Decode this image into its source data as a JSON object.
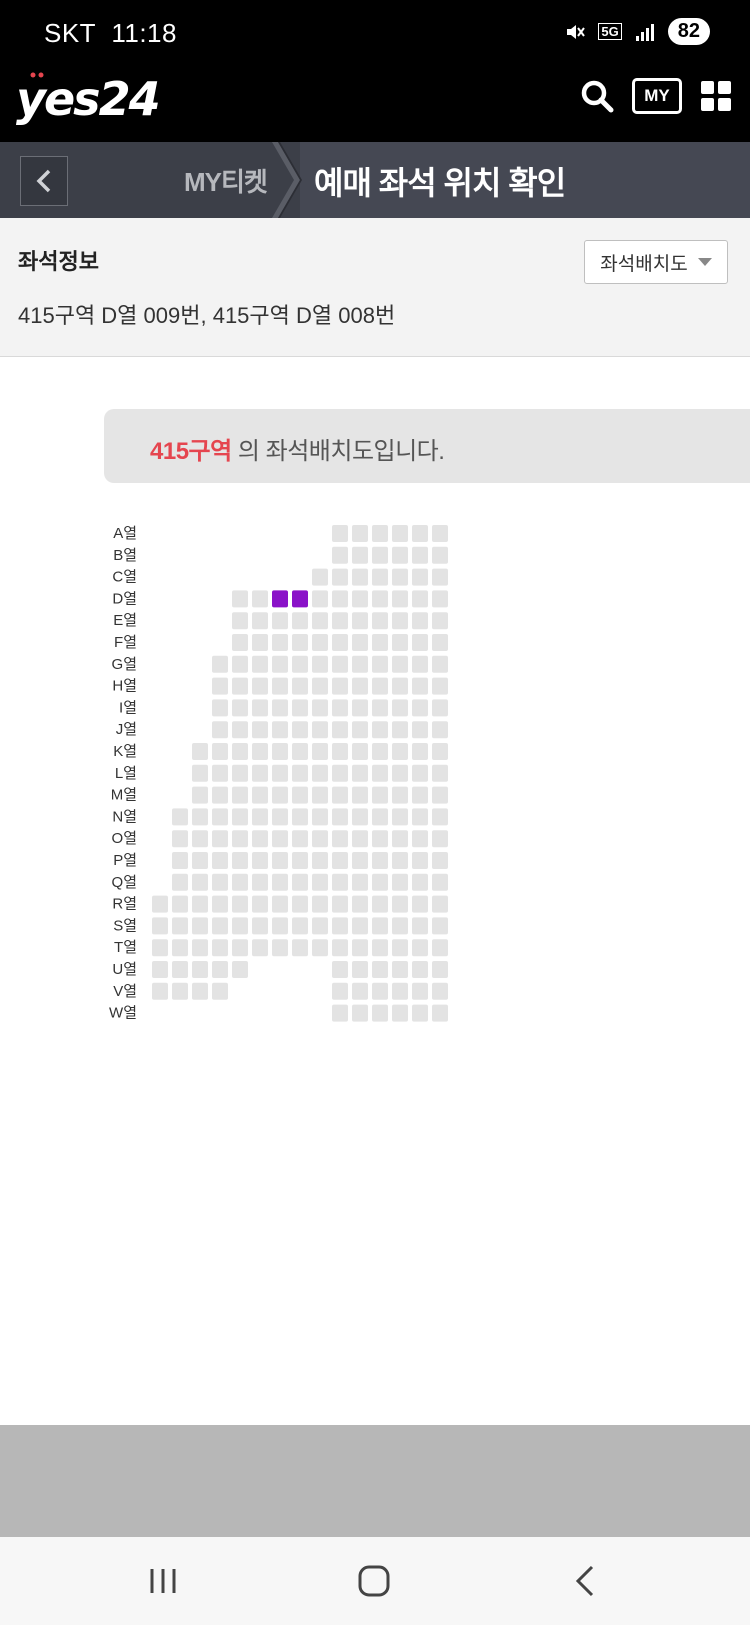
{
  "status": {
    "carrier": "SKT",
    "time": "11:18",
    "network": "5G",
    "battery": "82"
  },
  "header": {
    "brand": "yes24",
    "my_label": "MY"
  },
  "breadcrumb": {
    "parent": "MY티켓",
    "current": "예매 좌석 위치 확인"
  },
  "seat_info": {
    "title": "좌석정보",
    "value": "415구역 D열 009번, 415구역 D열 008번",
    "map_button": "좌석배치도"
  },
  "banner": {
    "zone": "415구역",
    "suffix": " 의 좌석배치도입니다."
  },
  "seat_map": {
    "rows": [
      "A열",
      "B열",
      "C열",
      "D열",
      "E열",
      "F열",
      "G열",
      "H열",
      "I열",
      "J열",
      "K열",
      "L열",
      "M열",
      "N열",
      "O열",
      "P열",
      "Q열",
      "R열",
      "S열",
      "T열",
      "U열",
      "V열",
      "W열"
    ],
    "row_columns": [
      [
        9,
        14
      ],
      [
        9,
        14
      ],
      [
        8,
        14
      ],
      [
        4,
        14
      ],
      [
        4,
        14
      ],
      [
        4,
        14
      ],
      [
        3,
        14
      ],
      [
        3,
        14
      ],
      [
        3,
        14
      ],
      [
        3,
        14
      ],
      [
        2,
        14
      ],
      [
        2,
        14
      ],
      [
        2,
        14
      ],
      [
        1,
        14
      ],
      [
        1,
        14
      ],
      [
        1,
        14
      ],
      [
        1,
        14
      ],
      [
        0,
        14
      ],
      [
        0,
        14
      ],
      [
        0,
        14
      ],
      [
        0,
        4
      ],
      [
        0,
        3
      ],
      [
        9,
        14
      ]
    ],
    "row_extra": {
      "U열": [
        9,
        14
      ],
      "V열": [
        9,
        14
      ]
    },
    "selected": [
      {
        "row": "D열",
        "col": 6
      },
      {
        "row": "D열",
        "col": 7
      }
    ],
    "seat_color": "#e3e3e3",
    "selected_color": "#8a12c8"
  },
  "colors": {
    "accent_red": "#e5454f"
  }
}
